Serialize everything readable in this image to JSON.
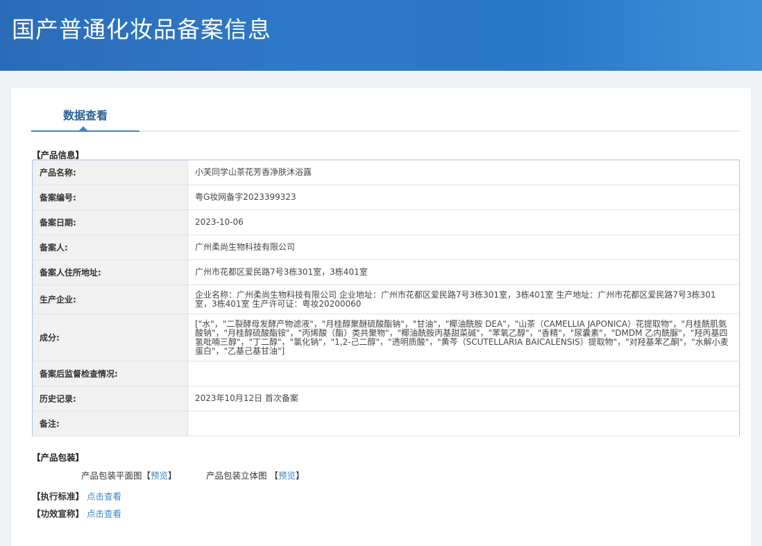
{
  "header": {
    "title": "国产普通化妆品备案信息"
  },
  "tab": {
    "label": "数据查看"
  },
  "product_info": {
    "heading": "【产品信息】",
    "rows": [
      {
        "label": "产品名称:",
        "value": "小芙同学山茶花芳香净肤沐浴露"
      },
      {
        "label": "备案编号:",
        "value": "粤G妆网备字2023399323"
      },
      {
        "label": "备案日期:",
        "value": "2023-10-06"
      },
      {
        "label": "备案人:",
        "value": "广州柔尚生物科技有限公司"
      },
      {
        "label": "备案人住所地址:",
        "value": "广州市花都区爱民路7号3栋301室，3栋401室"
      },
      {
        "label": "生产企业:",
        "value": "企业名称：广州柔尚生物科技有限公司 企业地址：广州市花都区爱民路7号3栋301室，3栋401室 生产地址：广州市花都区爱民路7号3栋301室，3栋401室 生产许可证：粤妆20200060"
      },
      {
        "label": "成分:",
        "value": "[\"水\"，\"二裂酵母发酵产物滤液\"，\"月桂醇聚醚硫酸酯钠\"，\"甘油\"，\"椰油酰胺 DEA\"，\"山茶（CAMELLIA JAPONICA）花提取物\"，\"月桂酰肌氨酸钠\"，\"月桂醇硫酸酯铵\"，\"丙烯酸（酯）类共聚物\"，\"椰油酰胺丙基甜菜碱\"，\"苯氧乙醇\"，\"香精\"，\"尿囊素\"，\"DMDM 乙内酰脲\"，\"羟丙基四氢吡喃三醇\"，\"丁二醇\"，\"氯化钠\"，\"1,2-己二醇\"，\"透明质酸\"，\"黄芩（SCUTELLARIA BAICALENSIS）提取物\"，\"对羟基苯乙酮\"，\"水解小麦蛋白\"，\"乙基己基甘油\"]"
      },
      {
        "label": "备案后监督检查情况:",
        "value": ""
      },
      {
        "label": "历史记录:",
        "value": "2023年10月12日 首次备案"
      },
      {
        "label": "备注:",
        "value": ""
      }
    ]
  },
  "packaging": {
    "heading": "【产品包装】",
    "flat_label": "产品包装平面图",
    "flat_link": "预览",
    "solid_label": "产品包装立体图",
    "solid_link": "预览",
    "bl": "【",
    "br": "】"
  },
  "standard": {
    "heading": "【执行标准】",
    "link": "点击查看"
  },
  "efficacy": {
    "heading": "【功效宣称】",
    "link": "点击查看"
  }
}
